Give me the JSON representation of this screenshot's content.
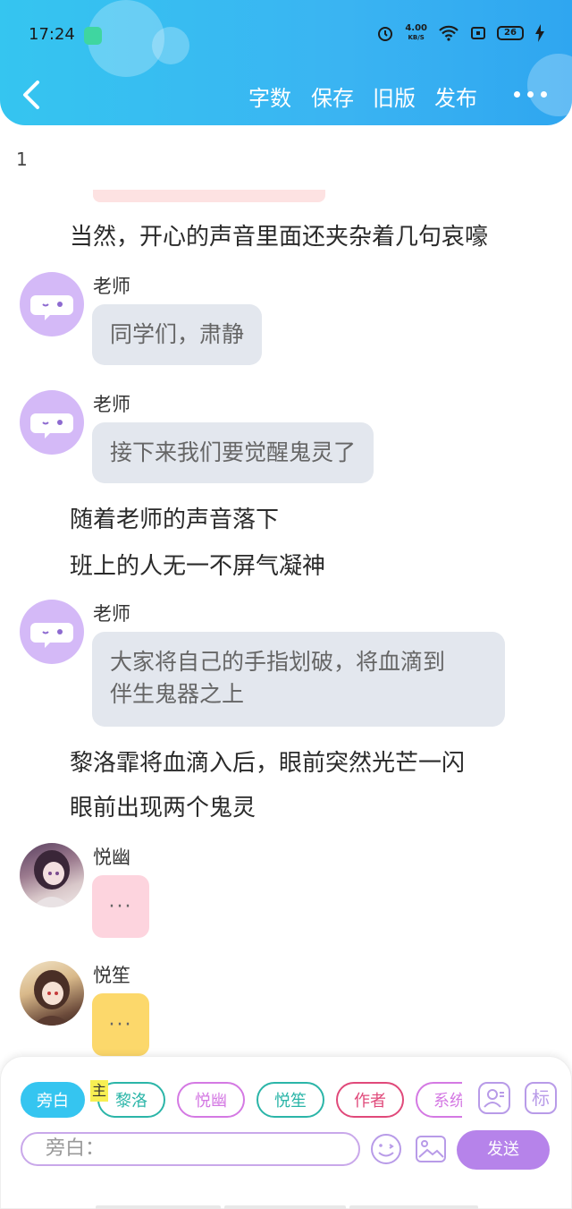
{
  "status_bar": {
    "time": "17:24",
    "speed_value": "4.00",
    "speed_unit": "KB/S",
    "battery": "26"
  },
  "toolbar": {
    "word_count": "字数",
    "save": "保存",
    "old_version": "旧版",
    "publish": "发布"
  },
  "editor": {
    "line_number": "1",
    "narration_1": "当然，开心的声音里面还夹杂着几句哀嚎",
    "msg_1": {
      "speaker": "老师",
      "text": "同学们，肃静"
    },
    "msg_2": {
      "speaker": "老师",
      "text": "接下来我们要觉醒鬼灵了"
    },
    "narration_2": "随着老师的声音落下",
    "narration_3": "班上的人无一不屏气凝神",
    "msg_3": {
      "speaker": "老师",
      "line1": "大家将自己的手指划破，将血滴到",
      "line2": "伴生鬼器之上"
    },
    "narration_4": "黎洛霏将血滴入后，眼前突然光芒一闪",
    "narration_5": "眼前出现两个鬼灵",
    "msg_4": {
      "speaker": "悦幽",
      "text": "···"
    },
    "msg_5": {
      "speaker": "悦笙",
      "text": "···"
    }
  },
  "composer": {
    "roles": {
      "narrator": "旁白",
      "liluo": "黎洛",
      "yueyou": "悦幽",
      "yuesheng": "悦笙",
      "author": "作者",
      "system": "系统"
    },
    "main_tag": "主",
    "mark_label": "标",
    "input_placeholder": "旁白：",
    "send": "发送"
  },
  "colors": {
    "header": "#35c5f0",
    "narrator_active": "#35c5f0",
    "liluo": "#2bb5a8",
    "yueyou": "#d479e3",
    "yuesheng": "#2bb5a8",
    "author": "#e0497a",
    "system": "#d479e3",
    "send": "#b683ea",
    "bubble_gray": "#e3e7ee",
    "bubble_pink": "#fdd4de",
    "bubble_yellow": "#fcd86b"
  },
  "icons": [
    "back-arrow-icon",
    "more-dots-icon",
    "alarm-icon",
    "wifi-icon",
    "battery-icon",
    "emoji-icon",
    "image-icon",
    "character-icon"
  ]
}
